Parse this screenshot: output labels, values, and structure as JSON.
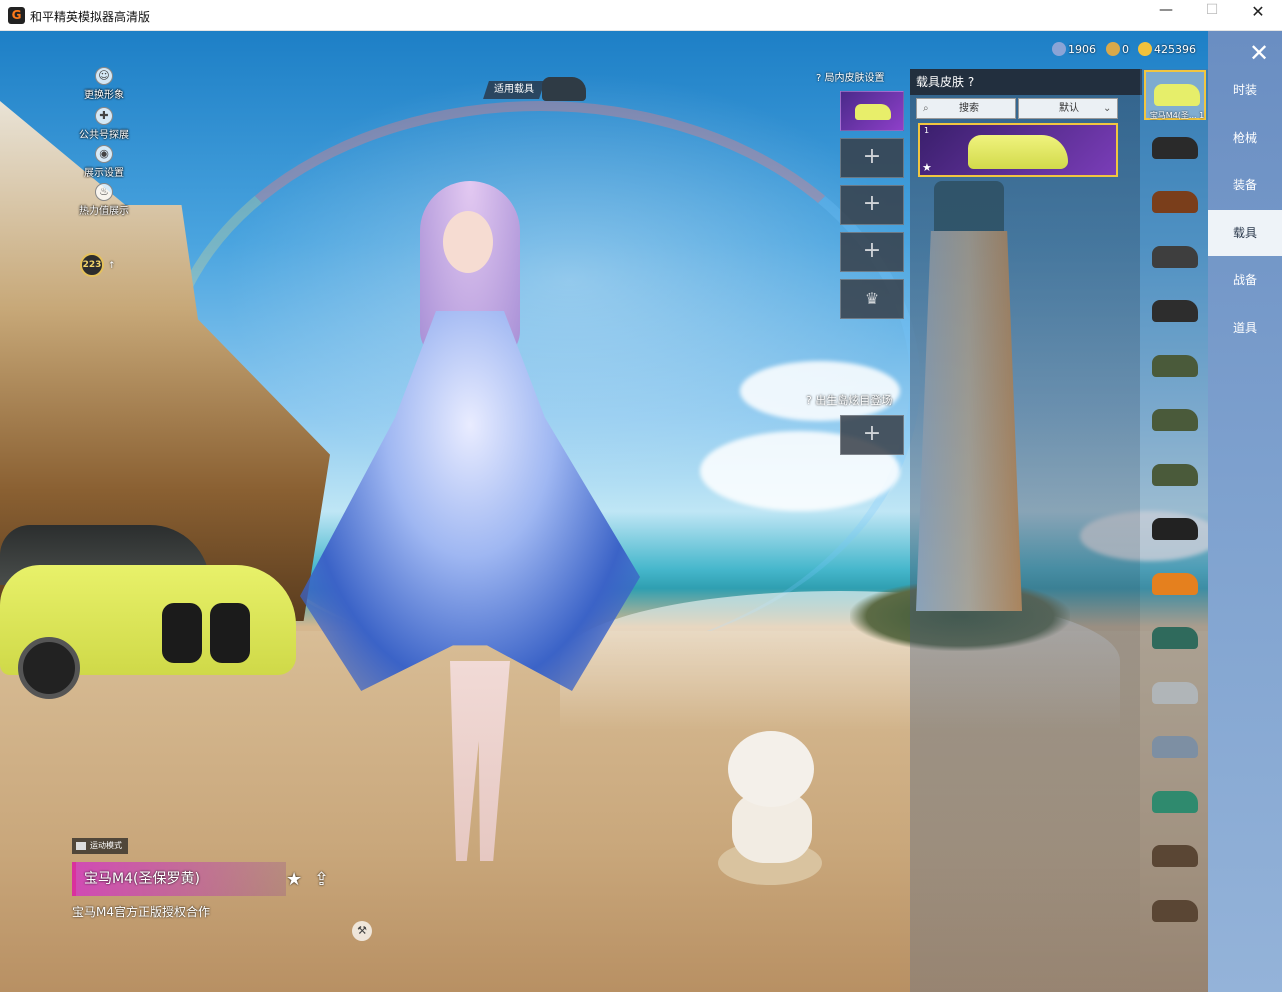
{
  "window": {
    "title": "和平精英模拟器高清版",
    "min": "—",
    "max": "☐",
    "close": "✕"
  },
  "left_actions": [
    {
      "label": "更换形象",
      "icon": "person-icon"
    },
    {
      "label": "公共号探展",
      "icon": "location-icon"
    },
    {
      "label": "展示设置",
      "icon": "eye-icon"
    },
    {
      "label": "热力值展示",
      "icon": "fire-icon"
    }
  ],
  "level": {
    "value": "223",
    "arrow": "↑"
  },
  "apply_vehicle_label": "适用载具",
  "currency": {
    "c1": "1906",
    "c2": "0",
    "c3": "425396"
  },
  "in_round": {
    "header": "局内皮肤设置",
    "plus": "+",
    "crown": "♛",
    "spawn_header": "出生岛炫目登场",
    "help_icon": "?"
  },
  "skin_panel": {
    "title": "载具皮肤",
    "search_icon": "⌕",
    "search_label": "搜索",
    "sort_label": "默认",
    "sort_arrow": "⌄",
    "card_num": "1",
    "card_star": "★"
  },
  "vehicles": [
    {
      "label": "宝马M4(圣... 1",
      "color": "#e6ee6a"
    },
    {
      "label": "",
      "color": "#2a2a2a"
    },
    {
      "label": "",
      "color": "#7a3e1b"
    },
    {
      "label": "",
      "color": "#3e3e3e"
    },
    {
      "label": "",
      "color": "#2d2d2d"
    },
    {
      "label": "",
      "color": "#4a5a3a"
    },
    {
      "label": "",
      "color": "#4a5a3a"
    },
    {
      "label": "",
      "color": "#4a5a3a"
    },
    {
      "label": "",
      "color": "#222222"
    },
    {
      "label": "",
      "color": "#e5801e"
    },
    {
      "label": "",
      "color": "#2f6a5c"
    },
    {
      "label": "",
      "color": "#b0b5b8"
    },
    {
      "label": "",
      "color": "#7d8fa3"
    },
    {
      "label": "",
      "color": "#2f8a6e"
    },
    {
      "label": "",
      "color": "#5a4634"
    },
    {
      "label": "",
      "color": "#5a4634"
    }
  ],
  "nav": [
    {
      "label": "时装",
      "active": false
    },
    {
      "label": "枪械",
      "active": false
    },
    {
      "label": "装备",
      "active": false
    },
    {
      "label": "载具",
      "active": true
    },
    {
      "label": "战备",
      "active": false
    },
    {
      "label": "道具",
      "active": false
    }
  ],
  "nav_close": "✕",
  "bottom": {
    "mode_badge": "运动模式",
    "vehicle_name": "宝马M4(圣保罗黄)",
    "description": "宝马M4官方正版授权合作",
    "fav_icon": "★",
    "share_icon": "⇪"
  },
  "colors": {
    "accent_gold": "#f1c640",
    "nav_bg": "#7fa2cf",
    "nav_active_bg": "#eef3f8"
  }
}
